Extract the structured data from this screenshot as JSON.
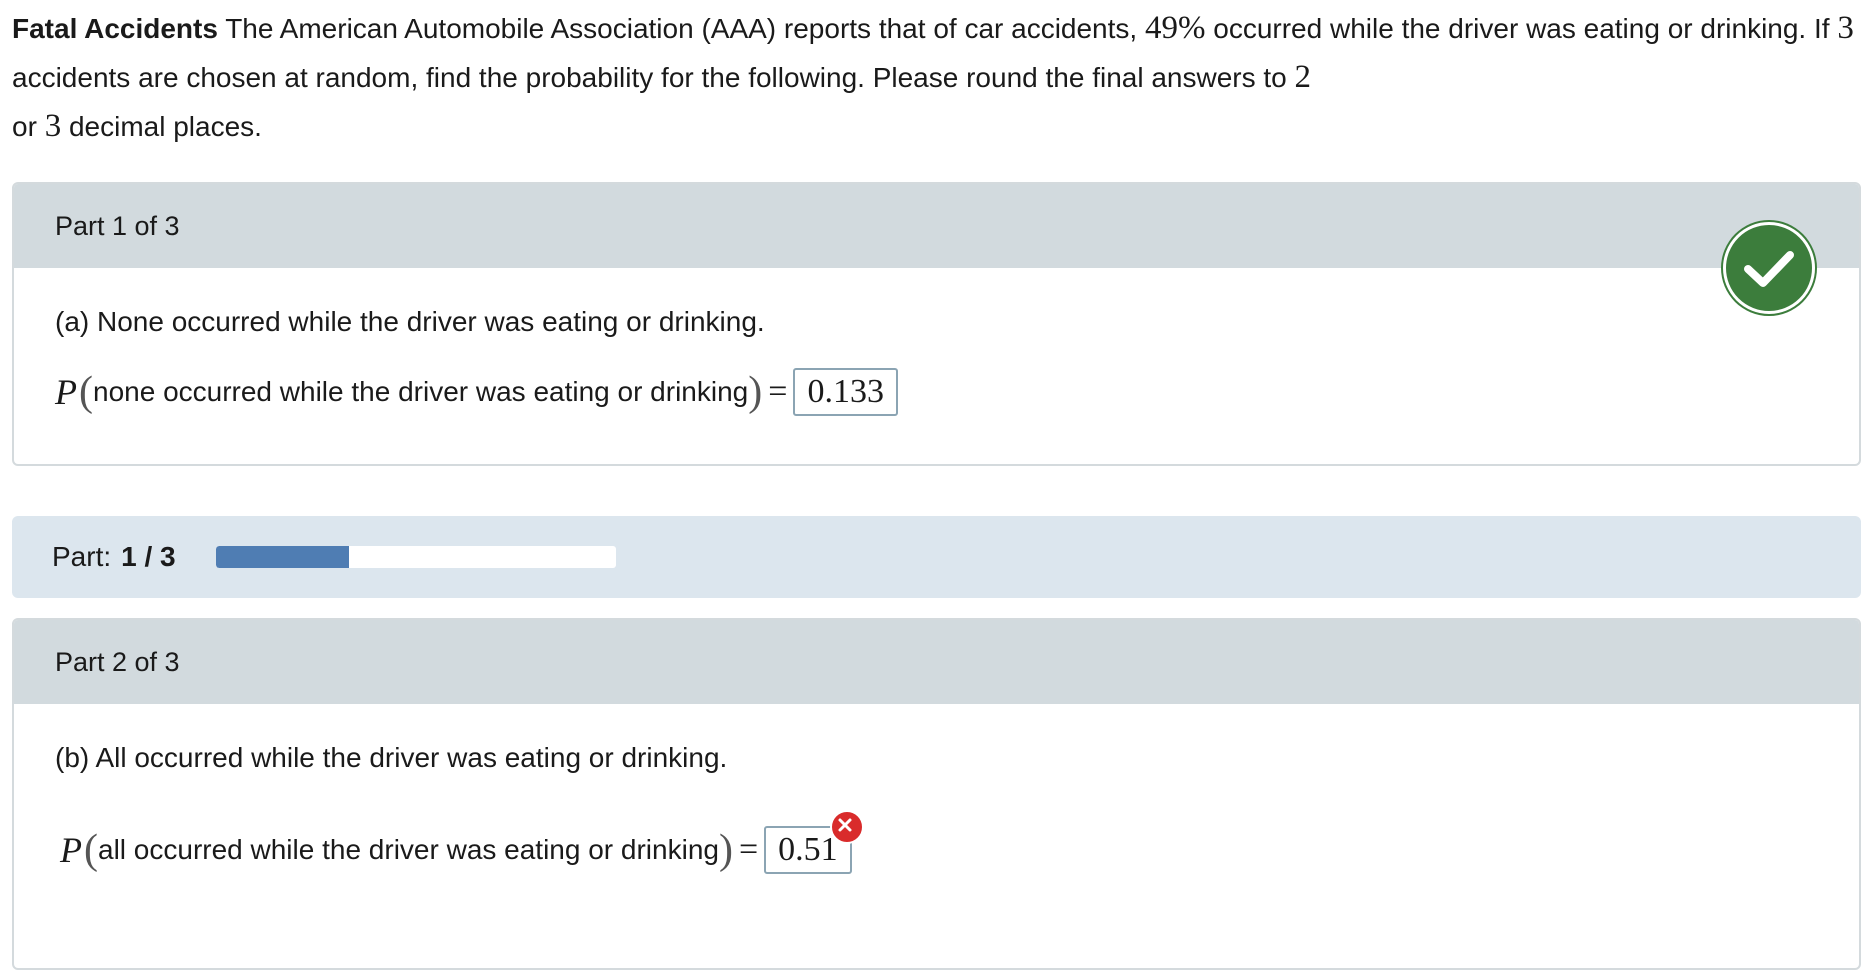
{
  "problem": {
    "title": "Fatal Accidents",
    "text_1": " The American Automobile Association (AAA) reports that of car accidents, ",
    "percent": "49%",
    "text_2": " occurred while the driver was eating or drinking. If ",
    "n": "3",
    "text_3": " accidents are chosen at random, find the probability for the following. Please round the final answers to ",
    "d1": "2",
    "text_4": " or ",
    "d2": "3",
    "text_5": " decimal places."
  },
  "part1": {
    "header": "Part 1 of 3",
    "question": "(a) None occurred while the driver was eating or drinking.",
    "p_symbol": "P",
    "event": "none occurred while the driver was eating or drinking",
    "answer": "0.133",
    "status": "correct",
    "status_icon": "check-circle-icon",
    "status_color": "#3c7d3c"
  },
  "progress": {
    "label": "Part:",
    "value": "1 / 3",
    "fraction": 0.333,
    "fill_color": "#4f7db3"
  },
  "part2": {
    "header": "Part 2 of 3",
    "question": "(b) All occurred while the driver was eating or drinking.",
    "p_symbol": "P",
    "event": "all occurred while the driver was eating or drinking",
    "answer": "0.51",
    "status": "incorrect",
    "status_icon": "x-circle-icon",
    "status_color": "#d92b2b"
  }
}
